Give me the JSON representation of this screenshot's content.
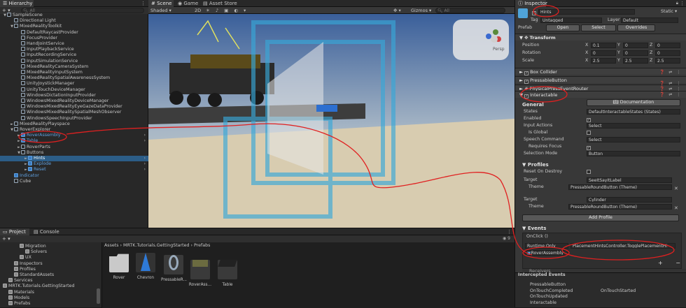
{
  "hierarchy": {
    "tab": "Hierarchy",
    "search_placeholder": "All",
    "rows": [
      {
        "label": "SampleScene",
        "indent": 0,
        "arrow": "▼"
      },
      {
        "label": "Directional Light",
        "indent": 1,
        "arrow": ""
      },
      {
        "label": "MixedRealityToolkit",
        "indent": 1,
        "arrow": "▼"
      },
      {
        "label": "DefaultRaycastProvider",
        "indent": 2,
        "arrow": ""
      },
      {
        "label": "FocusProvider",
        "indent": 2,
        "arrow": ""
      },
      {
        "label": "HandJointService",
        "indent": 2,
        "arrow": ""
      },
      {
        "label": "InputPlaybackService",
        "indent": 2,
        "arrow": ""
      },
      {
        "label": "InputRecordingService",
        "indent": 2,
        "arrow": ""
      },
      {
        "label": "InputSimulationService",
        "indent": 2,
        "arrow": ""
      },
      {
        "label": "MixedRealityCameraSystem",
        "indent": 2,
        "arrow": ""
      },
      {
        "label": "MixedRealityInputSystem",
        "indent": 2,
        "arrow": ""
      },
      {
        "label": "MixedRealitySpatialAwarenessSystem",
        "indent": 2,
        "arrow": ""
      },
      {
        "label": "UnityJoystickManager",
        "indent": 2,
        "arrow": ""
      },
      {
        "label": "UnityTouchDeviceManager",
        "indent": 2,
        "arrow": ""
      },
      {
        "label": "WindowsDictationInputProvider",
        "indent": 2,
        "arrow": ""
      },
      {
        "label": "WindowsMixedRealityDeviceManager",
        "indent": 2,
        "arrow": ""
      },
      {
        "label": "WindowsMixedRealityEyeGazeDataProvider",
        "indent": 2,
        "arrow": ""
      },
      {
        "label": "WindowsMixedRealitySpatialMeshObserver",
        "indent": 2,
        "arrow": ""
      },
      {
        "label": "WindowsSpeechInputProvider",
        "indent": 2,
        "arrow": ""
      },
      {
        "label": "MixedRealityPlayspace",
        "indent": 1,
        "arrow": "►"
      },
      {
        "label": "RoverExplorer",
        "indent": 1,
        "arrow": "▼"
      },
      {
        "label": "RoverAssembly",
        "indent": 2,
        "arrow": "►",
        "blue": true
      },
      {
        "label": "Table",
        "indent": 2,
        "arrow": "►",
        "blue": true
      },
      {
        "label": "RoverParts",
        "indent": 2,
        "arrow": "►"
      },
      {
        "label": "Buttons",
        "indent": 2,
        "arrow": "▼"
      },
      {
        "label": "Hints",
        "indent": 3,
        "arrow": "►",
        "blue": true,
        "selected": true
      },
      {
        "label": "Explode",
        "indent": 3,
        "arrow": "►",
        "blue": true
      },
      {
        "label": "Reset",
        "indent": 3,
        "arrow": "►",
        "blue": true
      },
      {
        "label": "Indicator",
        "indent": 1,
        "arrow": "",
        "blue": true
      },
      {
        "label": "Cube",
        "indent": 1,
        "arrow": ""
      }
    ]
  },
  "scene": {
    "tabs": [
      "Scene",
      "Game",
      "Asset Store"
    ],
    "shading": "Shaded",
    "mode_2d": "2D",
    "gizmos": "Gizmos",
    "search_placeholder": "All",
    "gizmo_label": "Persp"
  },
  "project": {
    "tabs": [
      "Project",
      "Console"
    ],
    "tree": [
      {
        "label": "Migration",
        "indent": 3
      },
      {
        "label": "Solvers",
        "indent": 4
      },
      {
        "label": "UX",
        "indent": 3
      },
      {
        "label": "Inspectors",
        "indent": 2
      },
      {
        "label": "Profiles",
        "indent": 2
      },
      {
        "label": "StandardAssets",
        "indent": 2
      },
      {
        "label": "Services",
        "indent": 1
      },
      {
        "label": "MRTK.Tutorials.GettingStarted",
        "indent": 0
      },
      {
        "label": "Materials",
        "indent": 1
      },
      {
        "label": "Models",
        "indent": 1
      },
      {
        "label": "Prefabs",
        "indent": 1
      }
    ],
    "breadcrumb": [
      "Assets",
      "MRTK.Tutorials.GettingStarted",
      "Prefabs"
    ],
    "assets": [
      {
        "label": "Rover",
        "kind": "folder"
      },
      {
        "label": "Chevron",
        "kind": "chevron"
      },
      {
        "label": "PressableR...",
        "kind": "button"
      },
      {
        "label": "RoverAss...",
        "kind": "rover"
      },
      {
        "label": "Table",
        "kind": "table"
      }
    ],
    "count": "9"
  },
  "inspector": {
    "tab": "Inspector",
    "object_name": "Hints",
    "static_label": "Static",
    "tag_label": "Tag",
    "tag_value": "Untagged",
    "layer_label": "Layer",
    "layer_value": "Default",
    "prefab_label": "Prefab",
    "open_label": "Open",
    "select_label": "Select",
    "overrides_label": "Overrides",
    "transform": {
      "title": "Transform",
      "rows": [
        {
          "label": "Position",
          "x": "0.1",
          "y": "0",
          "z": "0"
        },
        {
          "label": "Rotation",
          "x": "0",
          "y": "0",
          "z": "0"
        },
        {
          "label": "Scale",
          "x": "2.5",
          "y": "2.5",
          "z": "2.5"
        }
      ]
    },
    "components": [
      "Box Collider",
      "PressableButton",
      "PhysicalPressEventRouter",
      "Interactable"
    ],
    "general": {
      "title": "General",
      "documentation": "Documentation",
      "states_label": "States",
      "states_value": "DefaultInteractableStates (States)",
      "enabled_label": "Enabled",
      "input_actions_label": "Input Actions",
      "input_actions_value": "Select",
      "is_global_label": "Is Global",
      "speech_command_label": "Speech Command",
      "speech_command_value": "Select",
      "requires_focus_label": "Requires Focus",
      "selection_mode_label": "Selection Mode",
      "selection_mode_value": "Button"
    },
    "profiles": {
      "title": "Profiles",
      "reset_label": "Reset On Destroy",
      "items": [
        {
          "target_label": "Target",
          "target_value": "SeeItSayItLabel",
          "theme_label": "Theme",
          "theme_value": "PressableRoundButton (Theme)"
        },
        {
          "target_label": "Target",
          "target_value": "Cylinder",
          "theme_label": "Theme",
          "theme_value": "PressableRoundButton (Theme)"
        }
      ],
      "add_profile": "Add Profile"
    },
    "events": {
      "title": "Events",
      "onclick": "OnClick ()",
      "runtime": "Runtime Only",
      "function": "PlacementHintsController.TogglePlacementHi",
      "object": "RoverAssembly",
      "receivers": "Receivers"
    },
    "intercepted": {
      "title": "Intercepted Events",
      "col1": [
        "PressableButton",
        "OnTouchCompleted",
        "OnTouchUpdated",
        "Interactable"
      ],
      "col2": [
        "",
        "OnTouchStarted",
        "",
        ""
      ]
    }
  },
  "colors": {
    "accent": "#2c5d87",
    "prefab_blue": "#5fa0e0",
    "annotation": "#e02020"
  }
}
